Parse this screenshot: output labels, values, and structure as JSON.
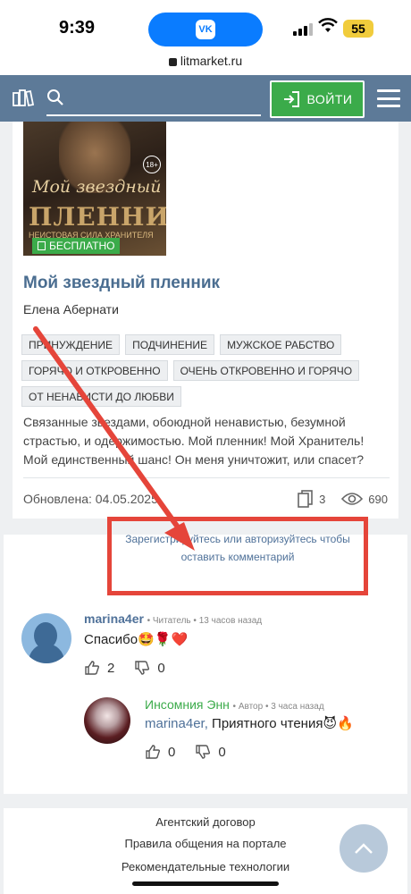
{
  "status_bar": {
    "time": "9:39",
    "battery": "55",
    "url": "litmarket.ru",
    "app_icon": "VK"
  },
  "header": {
    "login_label": "ВОЙТИ"
  },
  "book": {
    "cover_title_line1": "Мой звездный",
    "cover_title_line2": "ПЛЕННИК",
    "cover_subtitle": "НЕИСТОВАЯ СИЛА ХРАНИТЕЛЯ",
    "age_rating": "18+",
    "free_badge": "БЕСПЛАТНО",
    "title": "Мой звездный пленник",
    "author": "Елена Абернати",
    "tags": [
      "ПРИНУЖДЕНИЕ",
      "ПОДЧИНЕНИЕ",
      "МУЖСКОЕ РАБСТВО",
      "ГОРЯЧО И ОТКРОВЕННО",
      "ОЧЕНЬ ОТКРОВЕННО И ГОРЯЧО",
      "ОТ НЕНАВИСТИ ДО ЛЮБВИ"
    ],
    "description": "Связанные звездами, обоюдной ненавистью, безумной страстью, и одержимостью. Мой пленник! Мой Хранитель! Мой единственный шанс! Он меня уничтожит, или спасет?",
    "updated": "Обновлена: 04.05.2025",
    "copies": "3",
    "views": "690"
  },
  "comments": {
    "register_prompt_line1": "Зарегистрируйтесь или авторизуйтесь чтобы",
    "register_prompt_line2": "оставить комментарий",
    "items": [
      {
        "user": "marina4er",
        "role": "Читатель",
        "time": "13 часов назад",
        "text": "Спасибо🤩🌹❤️",
        "likes": "2",
        "dislikes": "0"
      },
      {
        "user": "Инсомния Энн",
        "role": "Автор",
        "time": "3 часа назад",
        "mention": "marina4er,",
        "text": " Приятного чтения😈🔥",
        "likes": "0",
        "dislikes": "0"
      }
    ]
  },
  "footer": {
    "links": [
      "Агентский договор",
      "Правила общения на портале",
      "Рекомендательные технологии"
    ]
  },
  "colors": {
    "header": "#5d7a98",
    "accent_green": "#3bab4a",
    "link_blue": "#4f7199",
    "highlight_red": "#e5453a"
  }
}
